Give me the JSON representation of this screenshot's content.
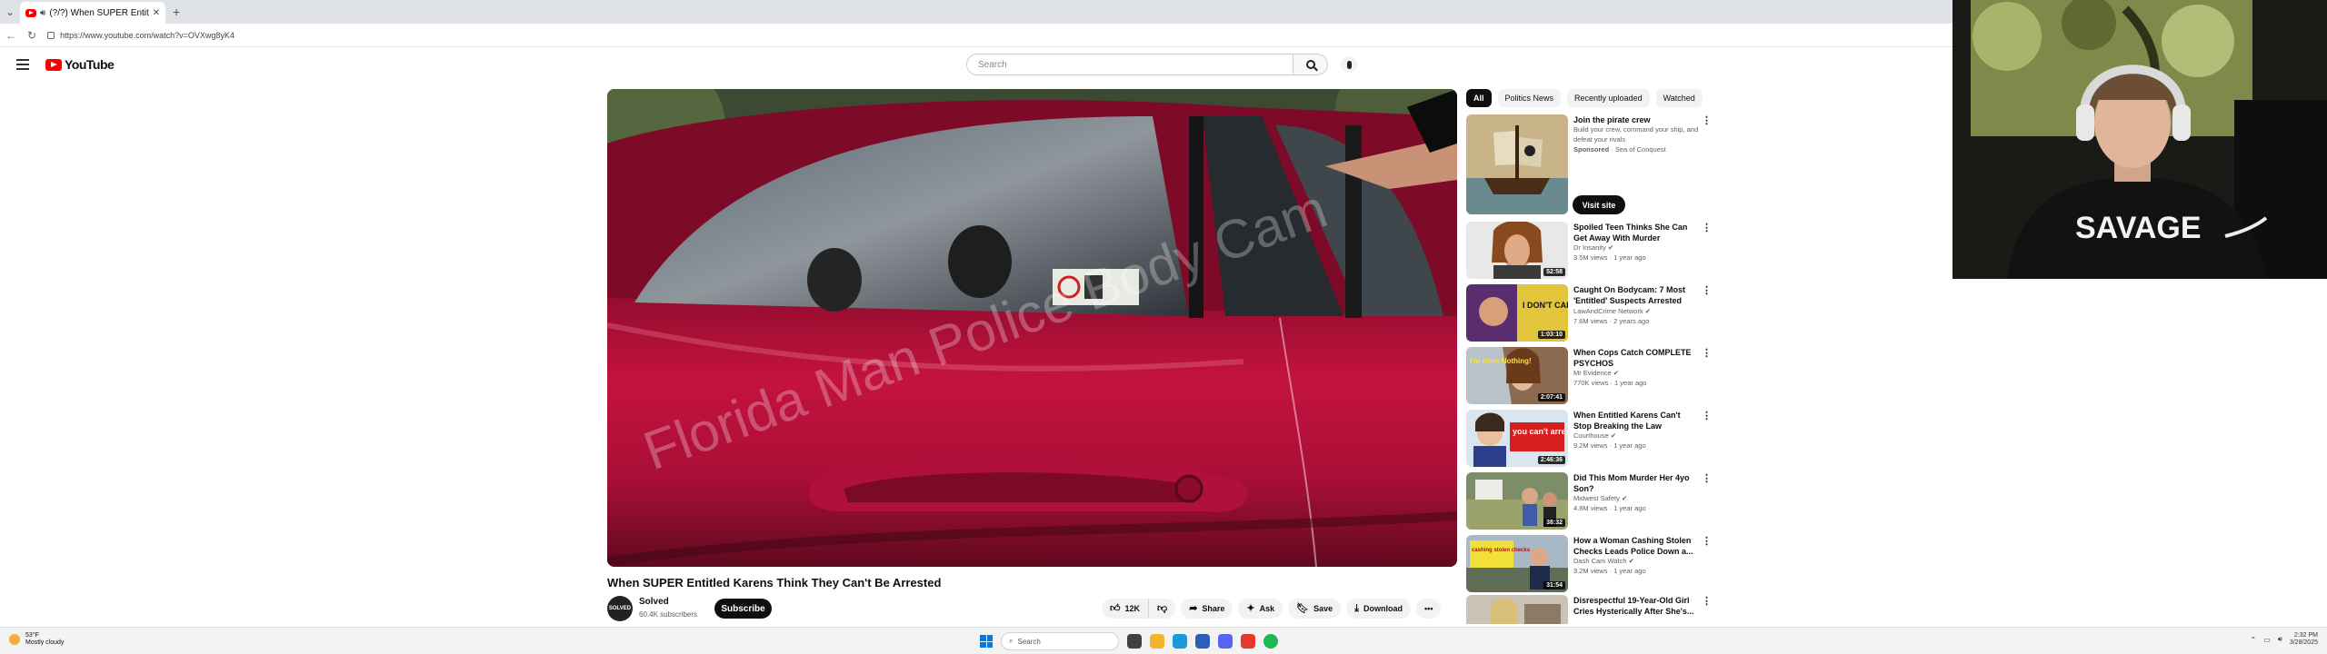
{
  "browser": {
    "tab_title": "(?/?) When SUPER Entitled Karens Think They Can't Be Arrested",
    "new_tab": "+",
    "url": "https://www.youtube.com/watch?v=OVXwg8yK4"
  },
  "header": {
    "logo": "YouTube",
    "search_placeholder": "Search"
  },
  "video": {
    "title": "When SUPER Entitled Karens Think They Can't Be Arrested",
    "watermark": "Florida Man Police Body Cam",
    "channel": {
      "avatar_text": "SOLVED",
      "name": "Solved",
      "subscribers": "60.4K subscribers"
    },
    "subscribe_label": "Subscribe",
    "actions": {
      "likes": "12K",
      "share": "Share",
      "ask": "Ask",
      "save": "Save",
      "download": "Download",
      "more": "•••"
    }
  },
  "sidebar": {
    "chips": [
      "All",
      "Politics News",
      "Recently uploaded",
      "Watched"
    ],
    "ad": {
      "title": "Join the pirate crew",
      "description": "Build your crew, command your ship, and defeat your rivals",
      "sponsored": "Sponsored",
      "advertiser": "· Sea of Conquest",
      "cta": "Visit site"
    },
    "items": [
      {
        "title": "Spoiled Teen Thinks She Can Get Away With Murder",
        "channel": "Dr Insanity",
        "stats": "3.5M views · 1 year ago",
        "duration": "52:58"
      },
      {
        "title": "Caught On Bodycam: 7 Most 'Entitled' Suspects Arrested by...",
        "channel": "LawAndCrime Network",
        "stats": "7.6M views · 2 years ago",
        "duration": "1:03:10"
      },
      {
        "title": "When Cops Catch COMPLETE PSYCHOS",
        "channel": "Mr Evidence",
        "stats": "770K views · 1 year ago",
        "duration": "2:07:41"
      },
      {
        "title": "When Entitled Karens Can't Stop Breaking the Law",
        "channel": "Courthouse",
        "stats": "9.2M views · 1 year ago",
        "duration": "2:46:36"
      },
      {
        "title": "Did This Mom Murder Her 4yo Son?",
        "channel": "Midwest Safety",
        "stats": "4.8M views · 1 year ago",
        "duration": "38:32"
      },
      {
        "title": "How a Woman Cashing Stolen Checks Leads Police Down a...",
        "channel": "Dash Cam Watch",
        "stats": "3.2M views · 1 year ago",
        "duration": "31:54"
      },
      {
        "title": "Disrespectful 19-Year-Old Girl Cries Hysterically After She's...",
        "channel": "",
        "stats": "",
        "duration": ""
      }
    ],
    "thumb_texts": {
      "t1": "I DON'T CARE!",
      "t2": "I'm done Nothing!",
      "t3": "you can't arrest me",
      "t4": "cashing stolen checks"
    }
  },
  "webcam": {
    "shirt_text": "SAVAGE"
  },
  "taskbar": {
    "temperature": "53°F",
    "weather": "Mostly cloudy",
    "search": "Search",
    "time": "2:32 PM",
    "date": "3/28/2025"
  },
  "colors": {
    "youtube_red": "#ff0000",
    "car_red": "#c4123f",
    "chip_active": "#0f0f0f"
  }
}
